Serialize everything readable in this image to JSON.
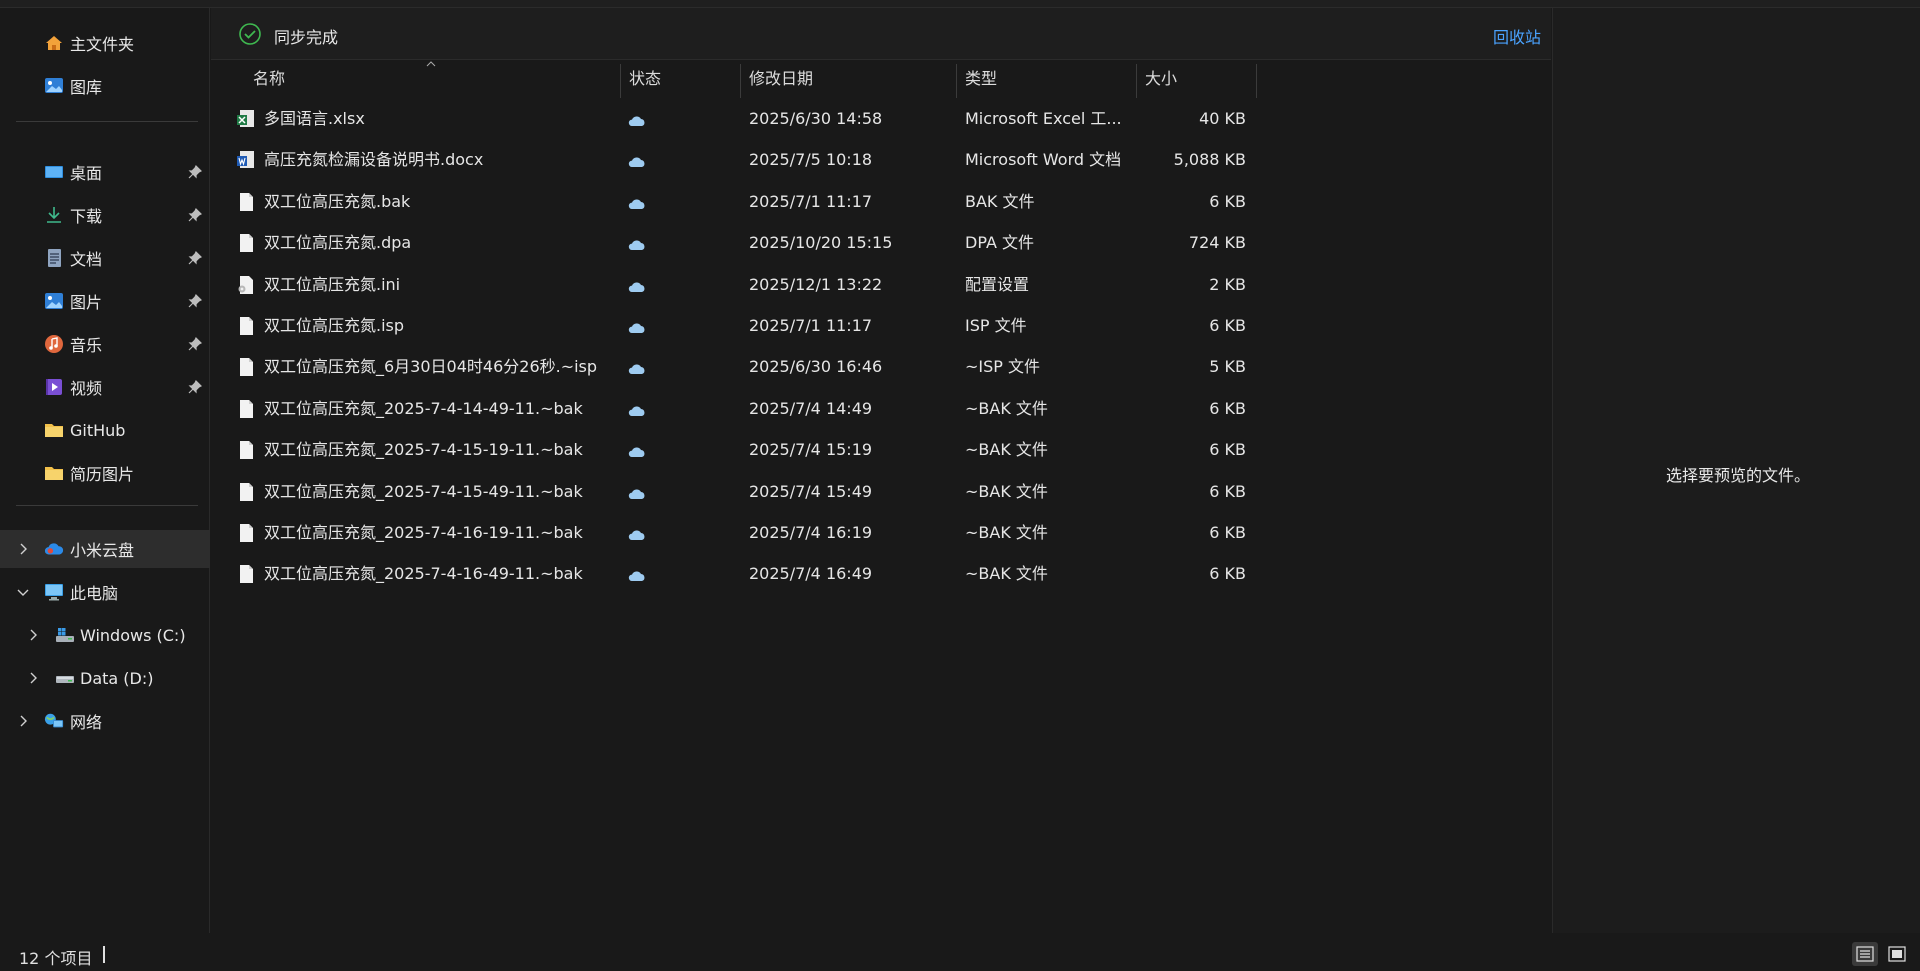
{
  "sidebar": {
    "quick": [
      {
        "label": "主文件夹",
        "icon": "home-icon"
      },
      {
        "label": "图库",
        "icon": "gallery-icon"
      }
    ],
    "pinned": [
      {
        "label": "桌面",
        "icon": "desktop-icon"
      },
      {
        "label": "下载",
        "icon": "download-icon"
      },
      {
        "label": "文档",
        "icon": "documents-icon"
      },
      {
        "label": "图片",
        "icon": "pictures-icon"
      },
      {
        "label": "音乐",
        "icon": "music-icon"
      },
      {
        "label": "视频",
        "icon": "videos-icon"
      }
    ],
    "folders": [
      {
        "label": "GitHub",
        "icon": "folder-icon"
      },
      {
        "label": "简历图片",
        "icon": "folder-icon"
      }
    ],
    "tree": [
      {
        "label": "小米云盘",
        "icon": "cloud-drive-icon"
      },
      {
        "label": "此电脑",
        "icon": "this-pc-icon"
      },
      {
        "label": "Windows (C:)",
        "icon": "windows-drive-icon"
      },
      {
        "label": "Data (D:)",
        "icon": "data-drive-icon"
      },
      {
        "label": "网络",
        "icon": "network-icon"
      }
    ]
  },
  "syncbar": {
    "status": "同步完成",
    "recycle_bin": "回收站"
  },
  "columns": {
    "name": "名称",
    "status": "状态",
    "modified": "修改日期",
    "type": "类型",
    "size": "大小"
  },
  "files": [
    {
      "name": "多国语言.xlsx",
      "modified": "2025/6/30 14:58",
      "type": "Microsoft Excel 工...",
      "size": "40 KB",
      "icon": "excel-file-icon"
    },
    {
      "name": "高压充氮检漏设备说明书.docx",
      "modified": "2025/7/5 10:18",
      "type": "Microsoft Word 文档",
      "size": "5,088 KB",
      "icon": "word-file-icon"
    },
    {
      "name": "双工位高压充氮.bak",
      "modified": "2025/7/1 11:17",
      "type": "BAK 文件",
      "size": "6 KB",
      "icon": "file-icon"
    },
    {
      "name": "双工位高压充氮.dpa",
      "modified": "2025/10/20 15:15",
      "type": "DPA 文件",
      "size": "724 KB",
      "icon": "file-icon"
    },
    {
      "name": "双工位高压充氮.ini",
      "modified": "2025/12/1 13:22",
      "type": "配置设置",
      "size": "2 KB",
      "icon": "config-file-icon"
    },
    {
      "name": "双工位高压充氮.isp",
      "modified": "2025/7/1 11:17",
      "type": "ISP 文件",
      "size": "6 KB",
      "icon": "file-icon"
    },
    {
      "name": "双工位高压充氮_6月30日04时46分26秒.~isp",
      "modified": "2025/6/30 16:46",
      "type": "~ISP 文件",
      "size": "5 KB",
      "icon": "file-icon"
    },
    {
      "name": "双工位高压充氮_2025-7-4-14-49-11.~bak",
      "modified": "2025/7/4 14:49",
      "type": "~BAK 文件",
      "size": "6 KB",
      "icon": "file-icon"
    },
    {
      "name": "双工位高压充氮_2025-7-4-15-19-11.~bak",
      "modified": "2025/7/4 15:19",
      "type": "~BAK 文件",
      "size": "6 KB",
      "icon": "file-icon"
    },
    {
      "name": "双工位高压充氮_2025-7-4-15-49-11.~bak",
      "modified": "2025/7/4 15:49",
      "type": "~BAK 文件",
      "size": "6 KB",
      "icon": "file-icon"
    },
    {
      "name": "双工位高压充氮_2025-7-4-16-19-11.~bak",
      "modified": "2025/7/4 16:19",
      "type": "~BAK 文件",
      "size": "6 KB",
      "icon": "file-icon"
    },
    {
      "name": "双工位高压充氮_2025-7-4-16-49-11.~bak",
      "modified": "2025/7/4 16:49",
      "type": "~BAK 文件",
      "size": "6 KB",
      "icon": "file-icon"
    }
  ],
  "preview": {
    "message": "选择要预览的文件。"
  },
  "statusbar": {
    "item_count": "12 个项目"
  },
  "colors": {
    "background": "#191919",
    "accent_link": "#4aa3ff",
    "sync_ok": "#3fb950",
    "cloud": "#9ecbf0"
  }
}
